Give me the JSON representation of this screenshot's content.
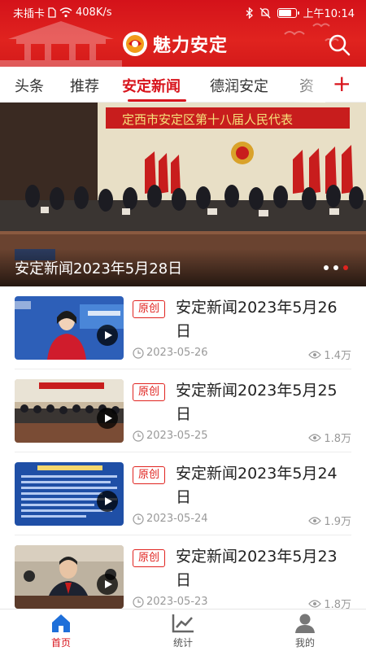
{
  "status_bar": {
    "carrier": "未插卡",
    "speed": "408K/s",
    "time": "上午10:14"
  },
  "app": {
    "title": "魅力安定",
    "brand_color": "#d8141c"
  },
  "tabs": [
    {
      "label": "头条",
      "active": false
    },
    {
      "label": "推荐",
      "active": false
    },
    {
      "label": "安定新闻",
      "active": true
    },
    {
      "label": "德润安定",
      "active": false
    },
    {
      "label": "资",
      "active": false
    }
  ],
  "add_tab_label": "+",
  "banner": {
    "caption": "安定新闻2023年5月28日",
    "backdrop_text": "定西市安定区第十八届人民代表",
    "slide_count": 3,
    "active_slide": 3
  },
  "news": [
    {
      "tag": "原创",
      "title": "安定新闻2023年5月26日",
      "date": "2023-05-26",
      "views": "1.4万"
    },
    {
      "tag": "原创",
      "title": "安定新闻2023年5月25日",
      "date": "2023-05-25",
      "views": "1.8万"
    },
    {
      "tag": "原创",
      "title": "安定新闻2023年5月24日",
      "date": "2023-05-24",
      "views": "1.9万"
    },
    {
      "tag": "原创",
      "title": "安定新闻2023年5月23日",
      "date": "2023-05-23",
      "views": "1.8万"
    }
  ],
  "bottom_nav": [
    {
      "label": "首页",
      "icon": "home-icon",
      "active": true
    },
    {
      "label": "统计",
      "icon": "chart-icon",
      "active": false
    },
    {
      "label": "我的",
      "icon": "user-icon",
      "active": false
    }
  ]
}
